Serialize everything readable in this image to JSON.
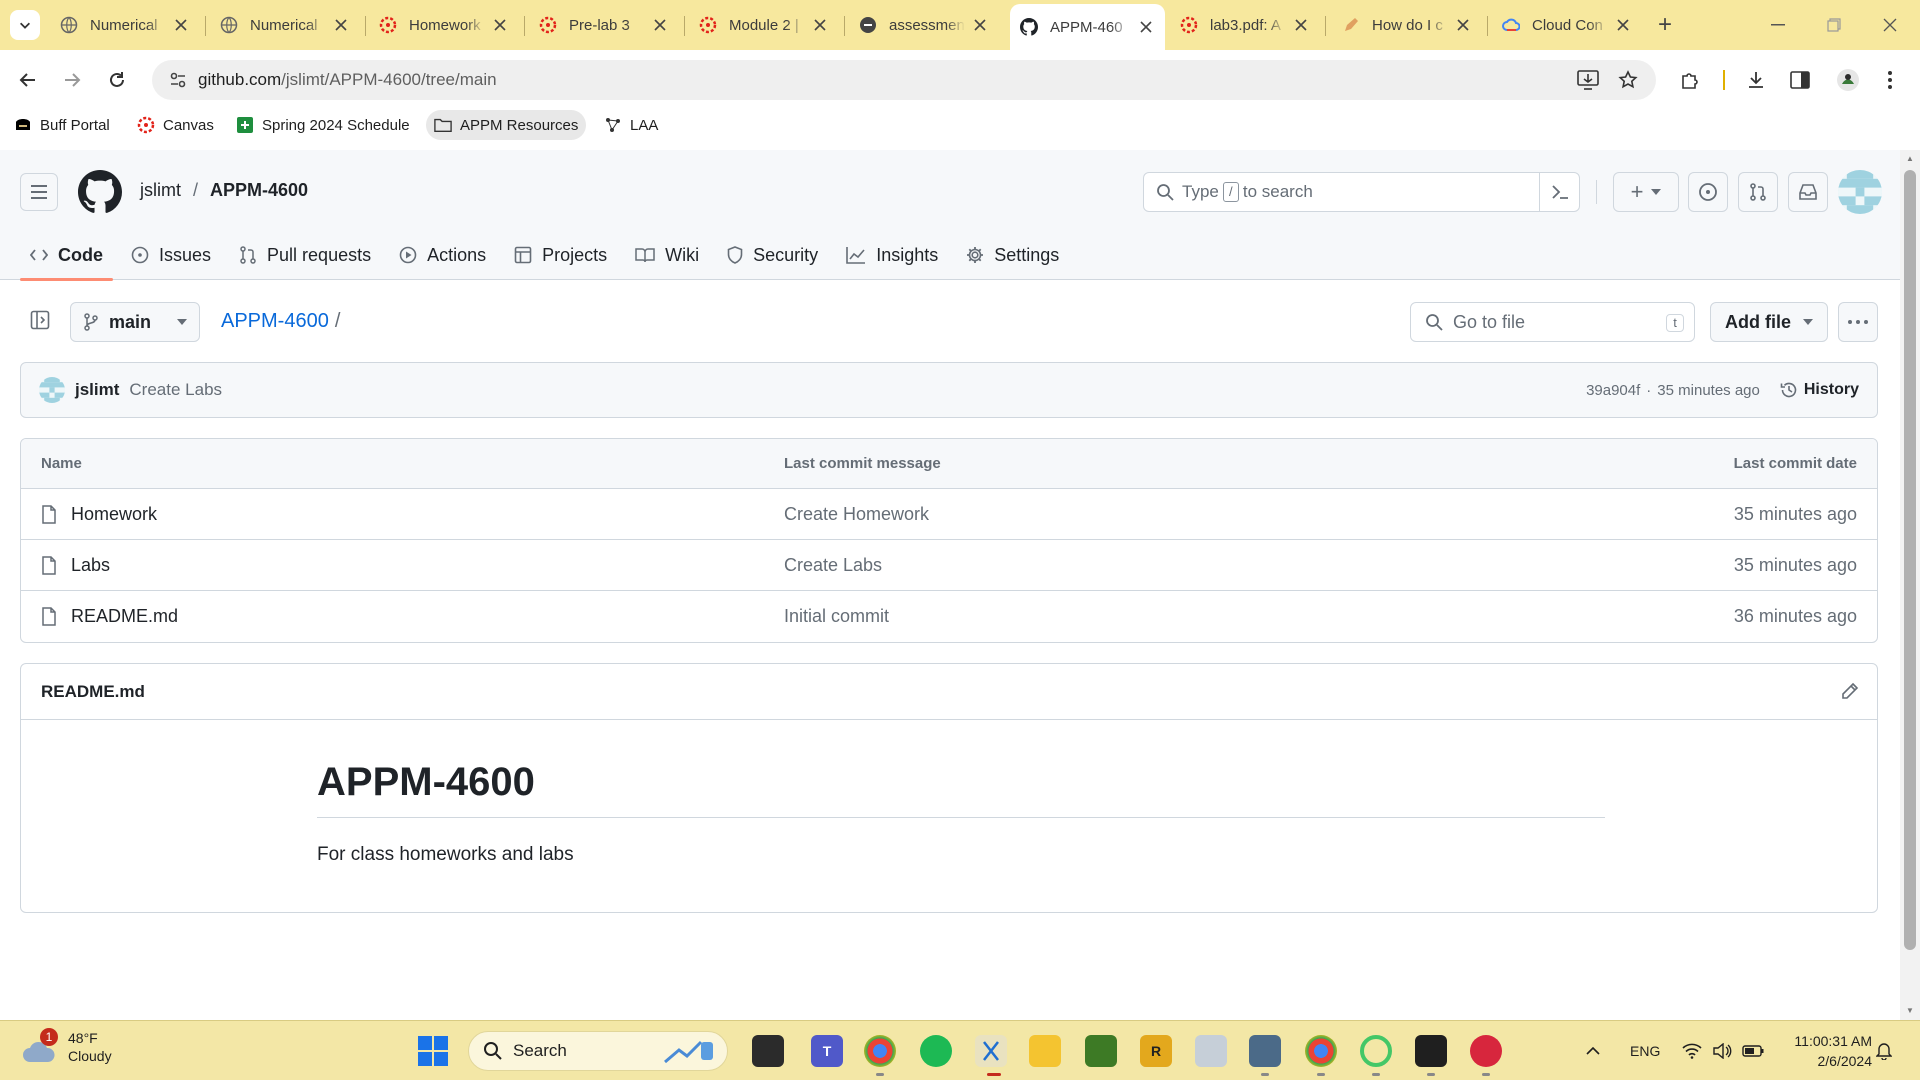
{
  "browser": {
    "tabs": [
      {
        "label": "Numerical",
        "icon": "globe-icon"
      },
      {
        "label": "Numerical",
        "icon": "globe-icon"
      },
      {
        "label": "Homework",
        "icon": "canvas-icon"
      },
      {
        "label": "Pre-lab 3",
        "icon": "canvas-icon"
      },
      {
        "label": "Module 2 |",
        "icon": "canvas-icon"
      },
      {
        "label": "assessmen",
        "icon": "link-icon"
      },
      {
        "label": "APPM-460",
        "icon": "github-icon",
        "active": true
      },
      {
        "label": "lab3.pdf: A",
        "icon": "canvas-icon"
      },
      {
        "label": "How do I c",
        "icon": "pen-icon"
      },
      {
        "label": "Cloud Con",
        "icon": "cloud-icon"
      }
    ],
    "new_tab": "+",
    "url_host": "github.com",
    "url_path": "/jslimt/APPM-4600/tree/main",
    "bookmarks": [
      "Buff Portal",
      "Canvas",
      "Spring 2024 Schedule",
      "APPM Resources",
      "LAA"
    ]
  },
  "header": {
    "owner": "jslimt",
    "separator": "/",
    "repo": "APPM-4600",
    "search_prefix": "Type",
    "search_key": "/",
    "search_suffix": "to search",
    "plus": "+"
  },
  "repo_nav": [
    "Code",
    "Issues",
    "Pull requests",
    "Actions",
    "Projects",
    "Wiki",
    "Security",
    "Insights",
    "Settings"
  ],
  "filebar": {
    "branch": "main",
    "path": "APPM-4600",
    "path_sep": "/",
    "goto_placeholder": "Go to file",
    "goto_key": "t",
    "add_file": "Add file"
  },
  "commit": {
    "user": "jslimt",
    "message": "Create Labs",
    "sha": "39a904f",
    "dot": "·",
    "time": "35 minutes ago",
    "history": "History"
  },
  "table": {
    "headers": {
      "name": "Name",
      "message": "Last commit message",
      "date": "Last commit date"
    },
    "rows": [
      {
        "name": "Homework",
        "message": "Create Homework",
        "date": "35 minutes ago"
      },
      {
        "name": "Labs",
        "message": "Create Labs",
        "date": "35 minutes ago"
      },
      {
        "name": "README.md",
        "message": "Initial commit",
        "date": "36 minutes ago"
      }
    ]
  },
  "readme": {
    "filename": "README.md",
    "title": "APPM-4600",
    "body": "For class homeworks and labs"
  },
  "taskbar": {
    "weather_badge": "1",
    "temperature": "48°F",
    "condition": "Cloudy",
    "search": "Search",
    "lang": "ENG",
    "time": "11:00:31 AM",
    "date": "2/6/2024"
  },
  "colors": {
    "chrome": "#f7e89e",
    "accent_underline": "#fd8c73",
    "link": "#0969da",
    "taskbar": "#f3e7a6"
  }
}
